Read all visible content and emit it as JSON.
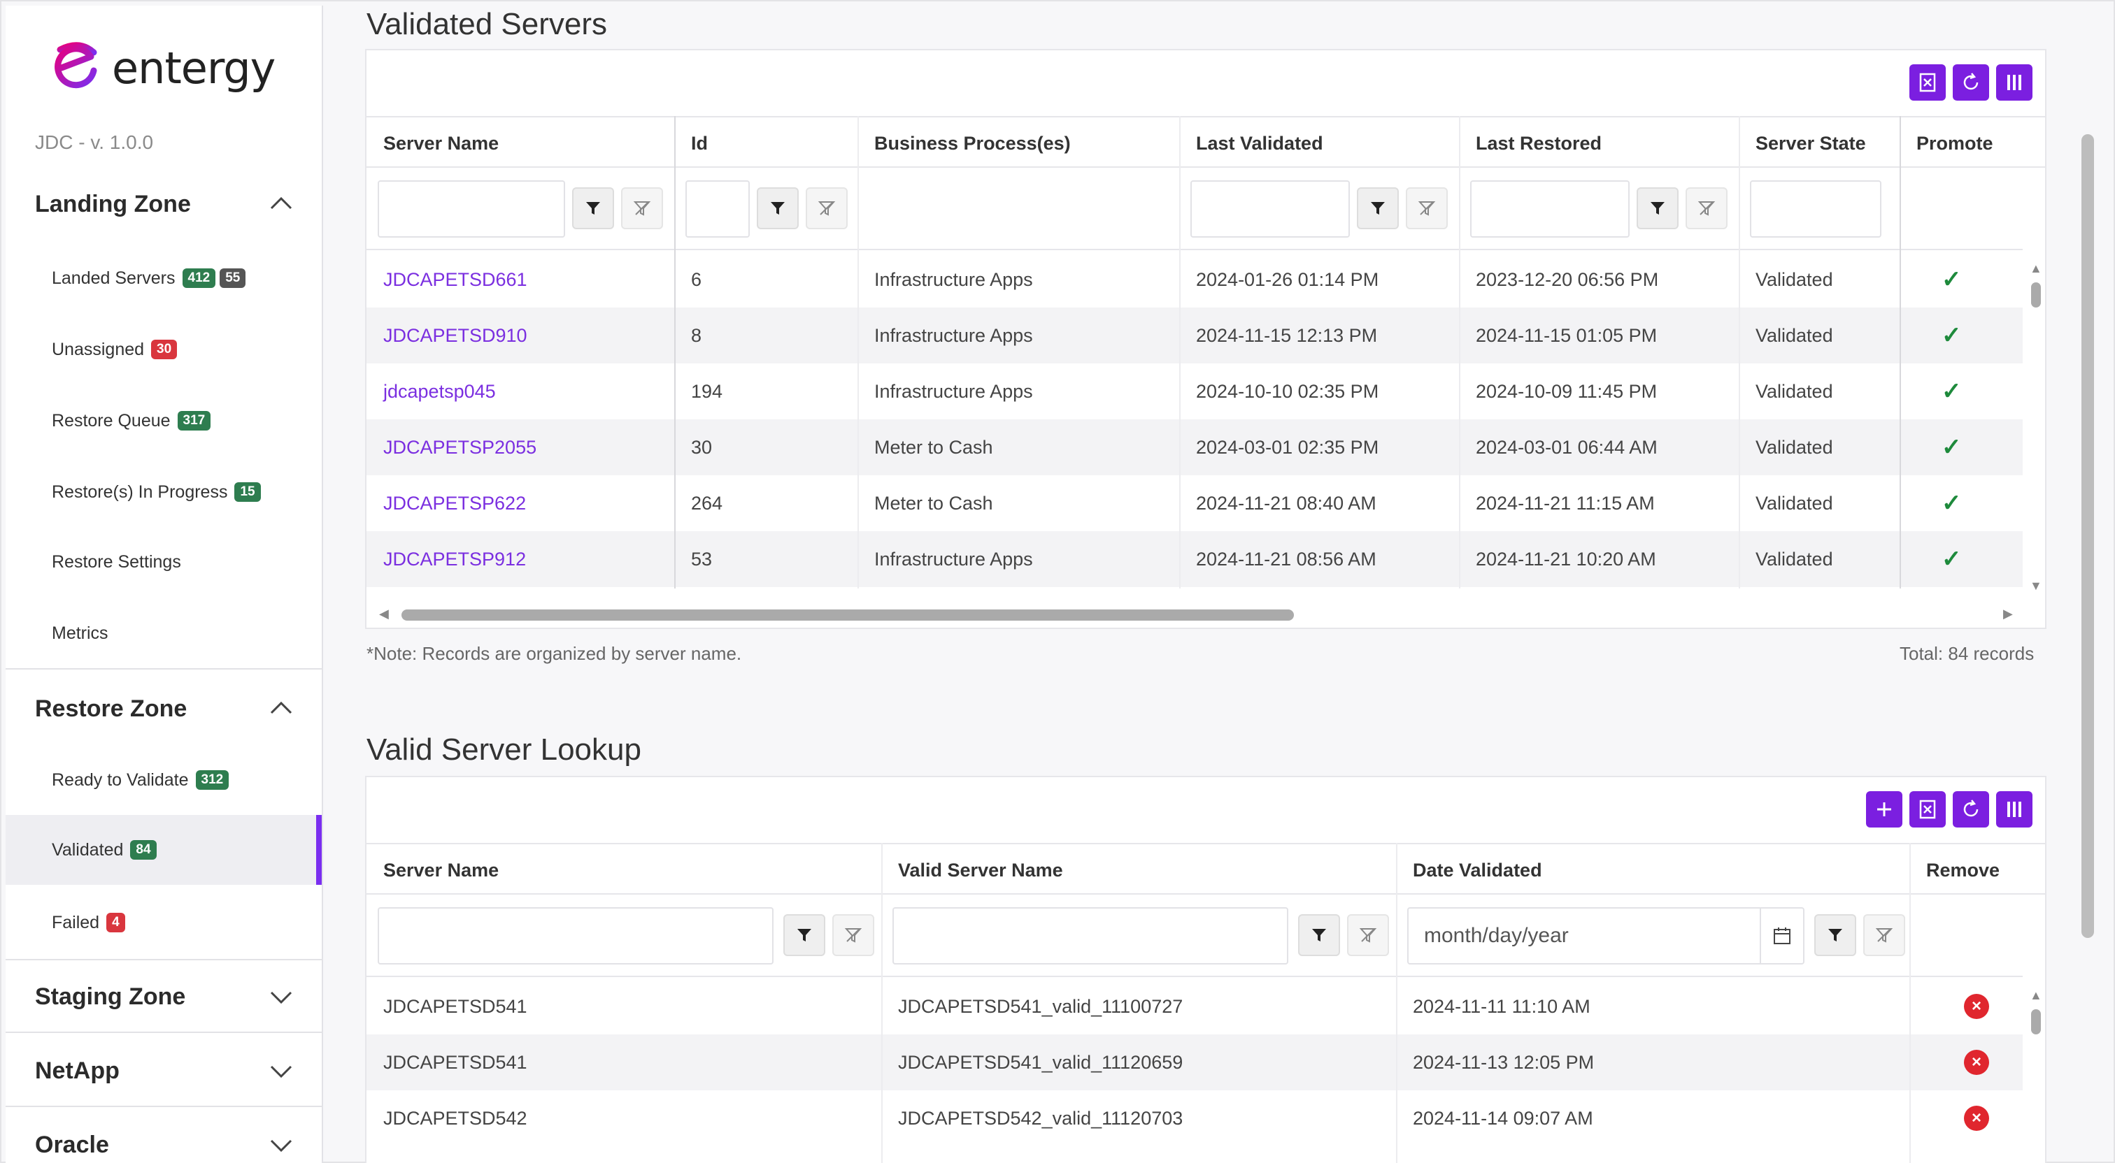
{
  "brand": {
    "name": "entergy",
    "version": "JDC - v. 1.0.0",
    "accent": "#7b1fe0"
  },
  "sidebar": {
    "landing_zone": {
      "title": "Landing Zone",
      "items": [
        {
          "label": "Landed Servers",
          "badges": [
            "412",
            "55"
          ]
        },
        {
          "label": "Unassigned",
          "badges": [
            "30"
          ]
        },
        {
          "label": "Restore Queue",
          "badges": [
            "317"
          ]
        },
        {
          "label": "Restore(s) In Progress",
          "badges": [
            "15"
          ]
        },
        {
          "label": "Restore Settings",
          "badges": []
        },
        {
          "label": "Metrics",
          "badges": []
        }
      ]
    },
    "restore_zone": {
      "title": "Restore Zone",
      "items": [
        {
          "label": "Ready to Validate",
          "badges": [
            "312"
          ]
        },
        {
          "label": "Validated",
          "badges": [
            "84"
          ]
        },
        {
          "label": "Failed",
          "badges": [
            "4"
          ]
        }
      ]
    },
    "staging_zone": {
      "title": "Staging Zone"
    },
    "netapp": {
      "title": "NetApp"
    },
    "oracle": {
      "title": "Oracle"
    }
  },
  "validated": {
    "title": "Validated Servers",
    "columns": [
      "Server Name",
      "Id",
      "Business Process(es)",
      "Last Validated",
      "Last Restored",
      "Server State",
      "Promote"
    ],
    "rows": [
      [
        "JDCAPETSD661",
        "6",
        "Infrastructure Apps",
        "2024-01-26 01:14 PM",
        "2023-12-20 06:56 PM",
        "Validated"
      ],
      [
        "JDCAPETSD910",
        "8",
        "Infrastructure Apps",
        "2024-11-15 12:13 PM",
        "2024-11-15 01:05 PM",
        "Validated"
      ],
      [
        "jdcapetsp045",
        "194",
        "Infrastructure Apps",
        "2024-10-10 02:35 PM",
        "2024-10-09 11:45 PM",
        "Validated"
      ],
      [
        "JDCAPETSP2055",
        "30",
        "Meter to Cash",
        "2024-03-01 02:35 PM",
        "2024-03-01 06:44 AM",
        "Validated"
      ],
      [
        "JDCAPETSP622",
        "264",
        "Meter to Cash",
        "2024-11-21 08:40 AM",
        "2024-11-21 11:15 AM",
        "Validated"
      ],
      [
        "JDCAPETSP912",
        "53",
        "Infrastructure Apps",
        "2024-11-21 08:56 AM",
        "2024-11-21 10:20 AM",
        "Validated"
      ]
    ],
    "note": "*Note: Records are organized by server name.",
    "total": "Total: 84 records"
  },
  "lookup": {
    "title": "Valid Server Lookup",
    "columns": [
      "Server Name",
      "Valid Server Name",
      "Date Validated",
      "Remove"
    ],
    "date_placeholder": "month/day/year",
    "rows": [
      [
        "JDCAPETSD541",
        "JDCAPETSD541_valid_11100727",
        "2024-11-11 11:10 AM"
      ],
      [
        "JDCAPETSD541",
        "JDCAPETSD541_valid_11120659",
        "2024-11-13 12:05 PM"
      ],
      [
        "JDCAPETSD542",
        "JDCAPETSD542_valid_11120703",
        "2024-11-14 09:07 AM"
      ]
    ]
  }
}
